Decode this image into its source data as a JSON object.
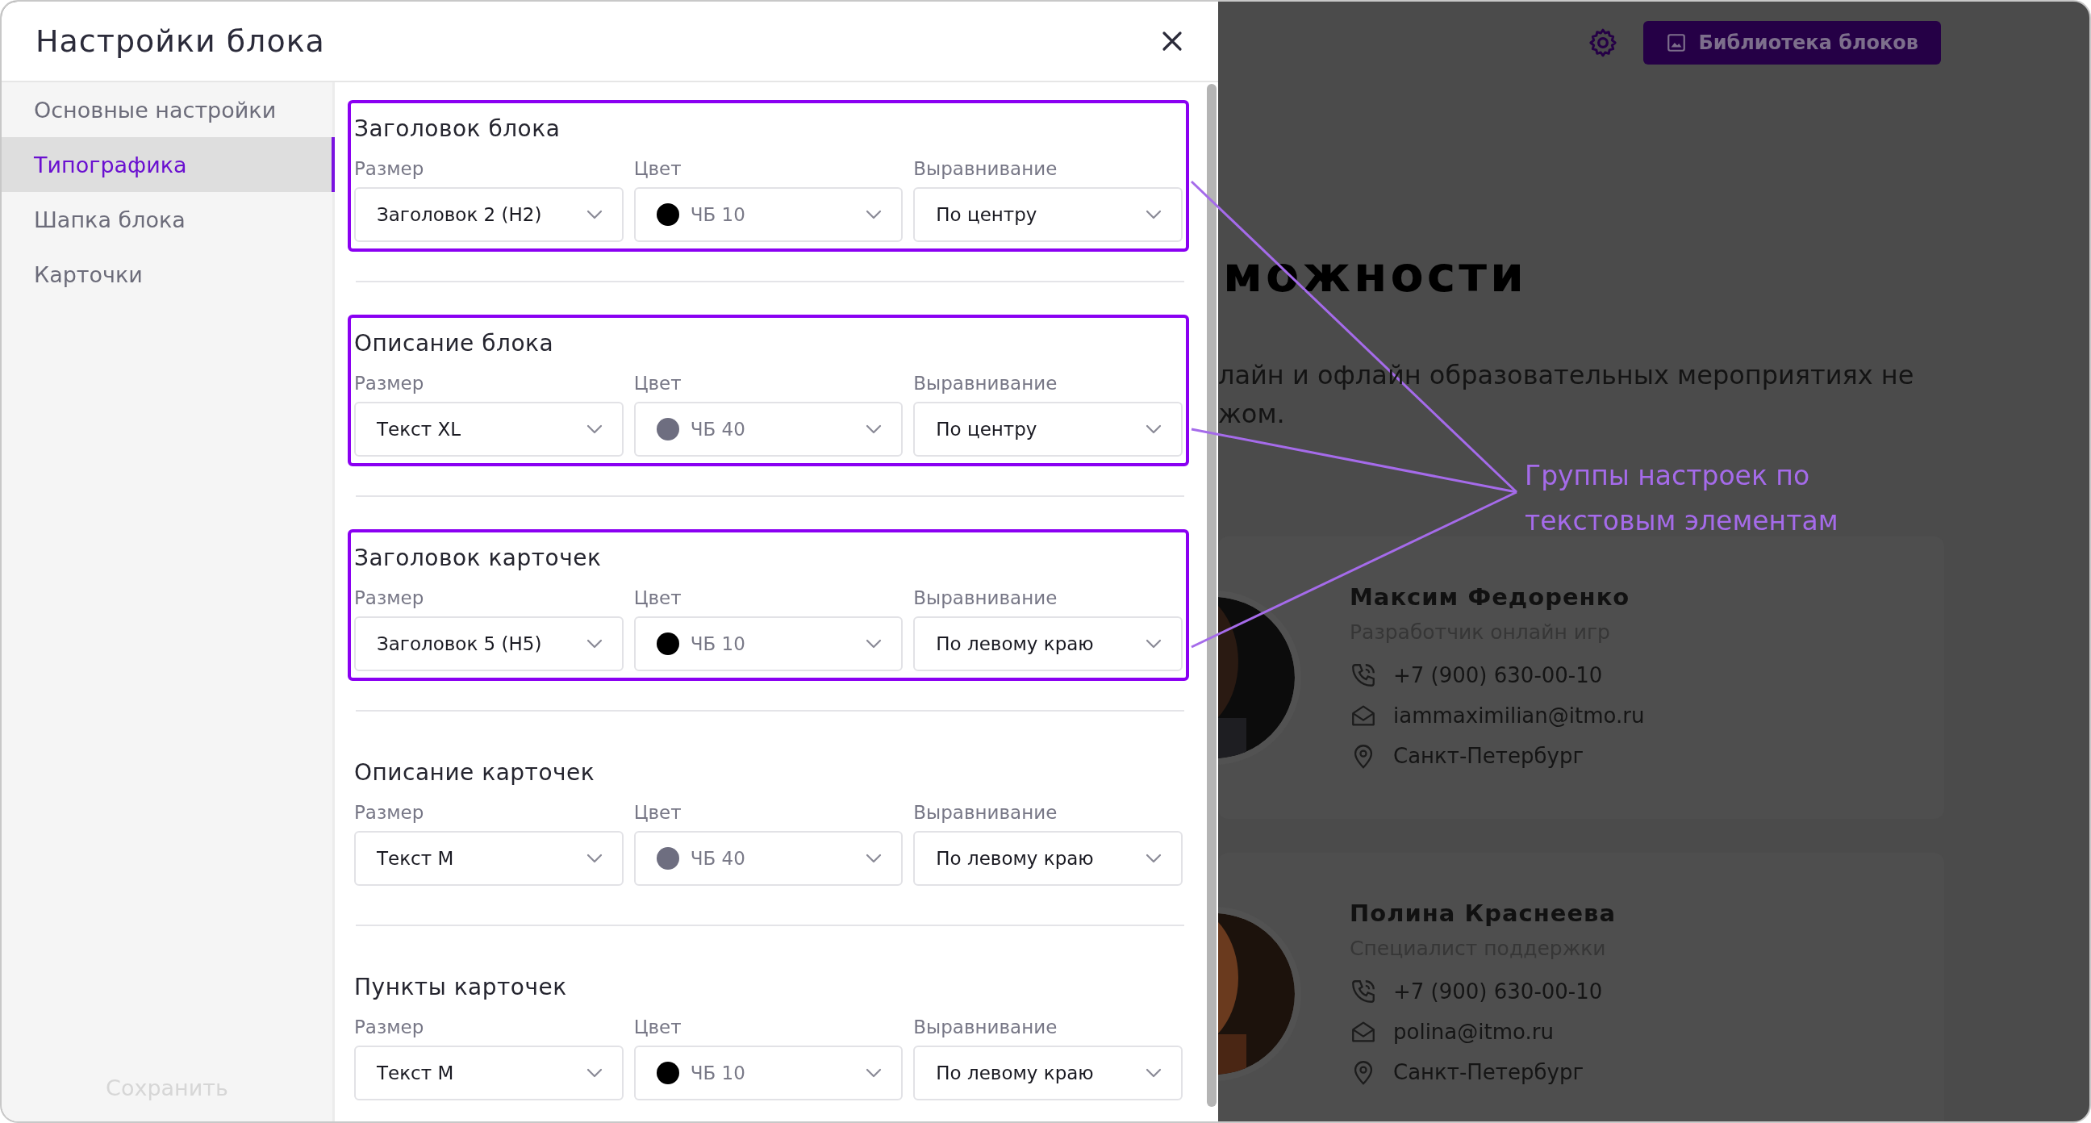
{
  "modal": {
    "title": "Настройки блока",
    "sidebar": [
      {
        "label": "Основные настройки",
        "selected": false
      },
      {
        "label": "Типографика",
        "selected": true
      },
      {
        "label": "Шапка блока",
        "selected": false
      },
      {
        "label": "Карточки",
        "selected": false
      }
    ],
    "save_button": "Сохранить",
    "groups": [
      {
        "title": "Заголовок блока",
        "highlighted": true,
        "fields": [
          {
            "label": "Размер",
            "value": "Заголовок 2 (H2)"
          },
          {
            "label": "Цвет",
            "value": "ЧБ 10",
            "color": "#000000"
          },
          {
            "label": "Выравнивание",
            "value": "По центру"
          }
        ]
      },
      {
        "title": "Описание блока",
        "highlighted": true,
        "fields": [
          {
            "label": "Размер",
            "value": "Текст XL"
          },
          {
            "label": "Цвет",
            "value": "ЧБ 40",
            "color": "#6e6e80"
          },
          {
            "label": "Выравнивание",
            "value": "По центру"
          }
        ]
      },
      {
        "title": "Заголовок карточек",
        "highlighted": true,
        "fields": [
          {
            "label": "Размер",
            "value": "Заголовок 5 (H5)"
          },
          {
            "label": "Цвет",
            "value": "ЧБ 10",
            "color": "#000000"
          },
          {
            "label": "Выравнивание",
            "value": "По левому краю"
          }
        ]
      },
      {
        "title": "Описание карточек",
        "highlighted": false,
        "fields": [
          {
            "label": "Размер",
            "value": "Текст M"
          },
          {
            "label": "Цвет",
            "value": "ЧБ 40",
            "color": "#6e6e80"
          },
          {
            "label": "Выравнивание",
            "value": "По левому краю"
          }
        ]
      },
      {
        "title": "Пункты карточек",
        "highlighted": false,
        "fields": [
          {
            "label": "Размер",
            "value": "Текст M"
          },
          {
            "label": "Цвет",
            "value": "ЧБ 10",
            "color": "#000000"
          },
          {
            "label": "Выравнивание",
            "value": "По левому краю"
          }
        ]
      }
    ]
  },
  "page": {
    "library_button": "Библиотека блоков",
    "heading": "можности",
    "description": [
      "лайн и офлайн образовательных мероприятиях не",
      "жом."
    ],
    "cards": [
      {
        "name": "Максим Федоренко",
        "role": "Разработчик онлайн игр",
        "phone": "+7 (900) 630-00-10",
        "email": "iammaximilian@itmo.ru",
        "city": "Санкт-Петербург"
      },
      {
        "name": "Полина Краснеева",
        "role": "Специалист поддержки",
        "phone": "+7 (900) 630-00-10",
        "email": "polina@itmo.ru",
        "city": "Санкт-Петербург"
      }
    ]
  },
  "annotation": "Группы настроек по текстовым элементам"
}
